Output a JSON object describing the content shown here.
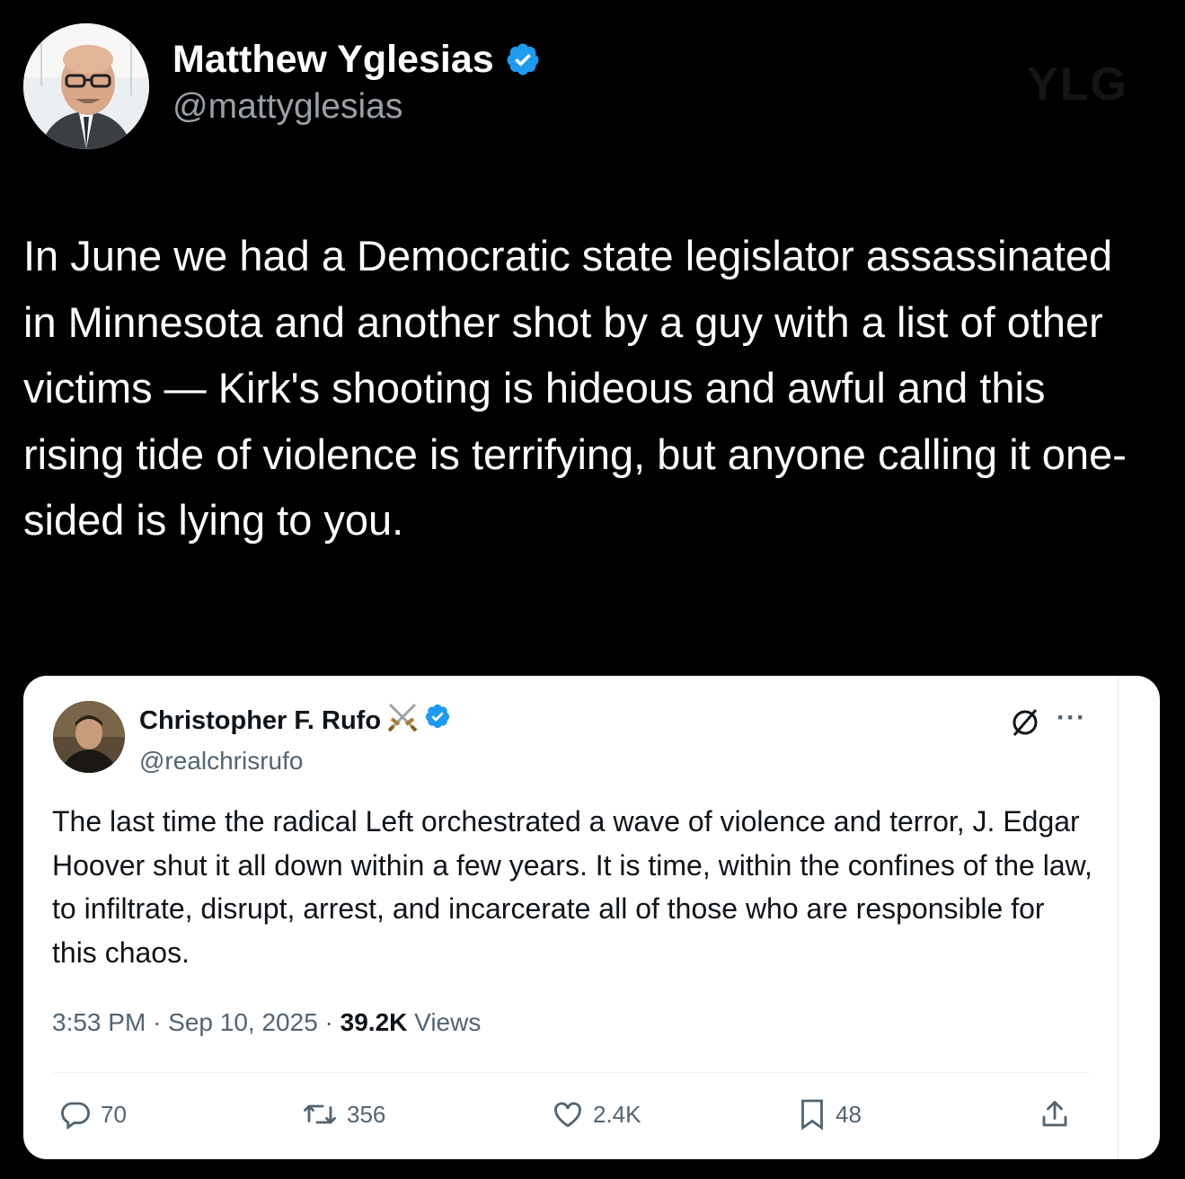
{
  "main_tweet": {
    "author_name": "Matthew Yglesias",
    "author_handle": "@mattyglesias",
    "verified": true,
    "text": "In June we had a Democratic state legislator assassinated in Minnesota and another shot by a guy with a list of other victims — Kirk's shooting is hideous and awful and this rising tide of violence is terrifying, but anyone calling it one-sided is lying to you.",
    "watermark": "YLG"
  },
  "quoted_tweet": {
    "author_name": "Christopher F. Rufo",
    "name_emoji": "⚔️",
    "author_handle": "@realchrisrufo",
    "verified": true,
    "text": "The last time the radical Left orchestrated a wave of violence and terror, J. Edgar Hoover shut it all down within a few years. It is time, within the confines of the law, to infiltrate, disrupt, arrest, and incarcerate all of those who are responsible for this chaos.",
    "time": "3:53 PM",
    "date": "Sep 10, 2025",
    "views_count": "39.2K",
    "views_label": "Views",
    "more_label": "···",
    "actions": {
      "replies": "70",
      "reposts": "356",
      "likes": "2.4K",
      "bookmarks": "48"
    }
  },
  "colors": {
    "background": "#000000",
    "card": "#ffffff",
    "verified_blue": "#1d9bf0",
    "muted": "#536471"
  },
  "icons": [
    "verified-badge-icon",
    "crossed-swords-icon",
    "grok-icon",
    "more-icon",
    "reply-icon",
    "repost-icon",
    "like-icon",
    "bookmark-icon",
    "share-icon"
  ]
}
